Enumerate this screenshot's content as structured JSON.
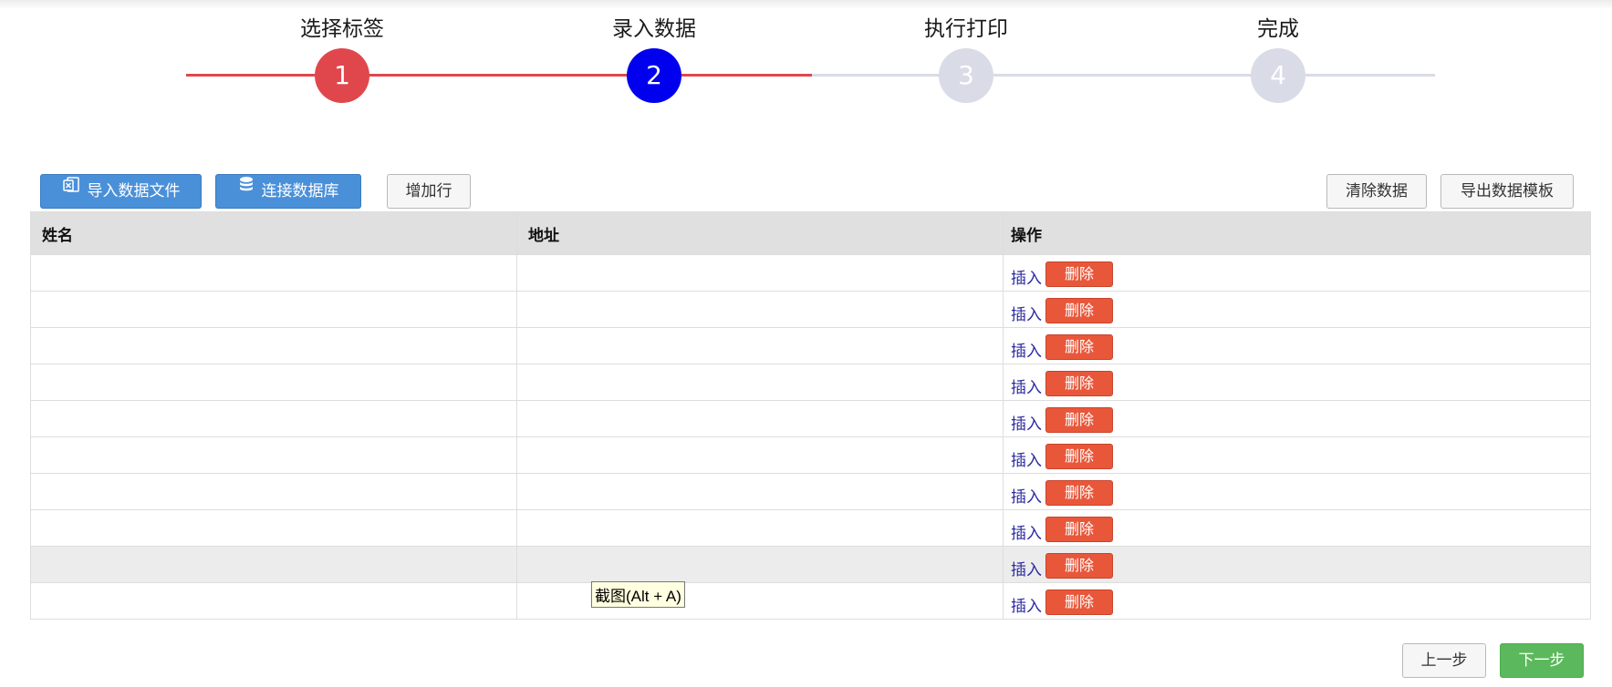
{
  "steps": [
    {
      "label": "选择标签",
      "number": "1",
      "state": "done"
    },
    {
      "label": "录入数据",
      "number": "2",
      "state": "active"
    },
    {
      "label": "执行打印",
      "number": "3",
      "state": "pending"
    },
    {
      "label": "完成",
      "number": "4",
      "state": "pending"
    }
  ],
  "toolbar": {
    "import_file": "导入数据文件",
    "connect_db": "连接数据库",
    "add_row": "增加行",
    "clear_data": "清除数据",
    "export_template": "导出数据模板"
  },
  "table": {
    "headers": [
      "姓名",
      "地址",
      "操作"
    ],
    "insert_label": "插入",
    "delete_label": "删除",
    "rows": [
      {
        "name": "",
        "address": ""
      },
      {
        "name": "",
        "address": ""
      },
      {
        "name": "",
        "address": ""
      },
      {
        "name": "",
        "address": ""
      },
      {
        "name": "",
        "address": ""
      },
      {
        "name": "",
        "address": ""
      },
      {
        "name": "",
        "address": ""
      },
      {
        "name": "",
        "address": ""
      },
      {
        "name": "",
        "address": ""
      },
      {
        "name": "",
        "address": ""
      }
    ]
  },
  "tooltip": "截图(Alt + A)",
  "footer": {
    "prev": "上一步",
    "next": "下一步"
  },
  "colors": {
    "step_done": "#e0474c",
    "step_active": "#0000ef",
    "step_pending": "#d9dbe6",
    "primary_blue": "#4a90d9",
    "danger": "#e9573a",
    "success": "#5cb85c"
  }
}
